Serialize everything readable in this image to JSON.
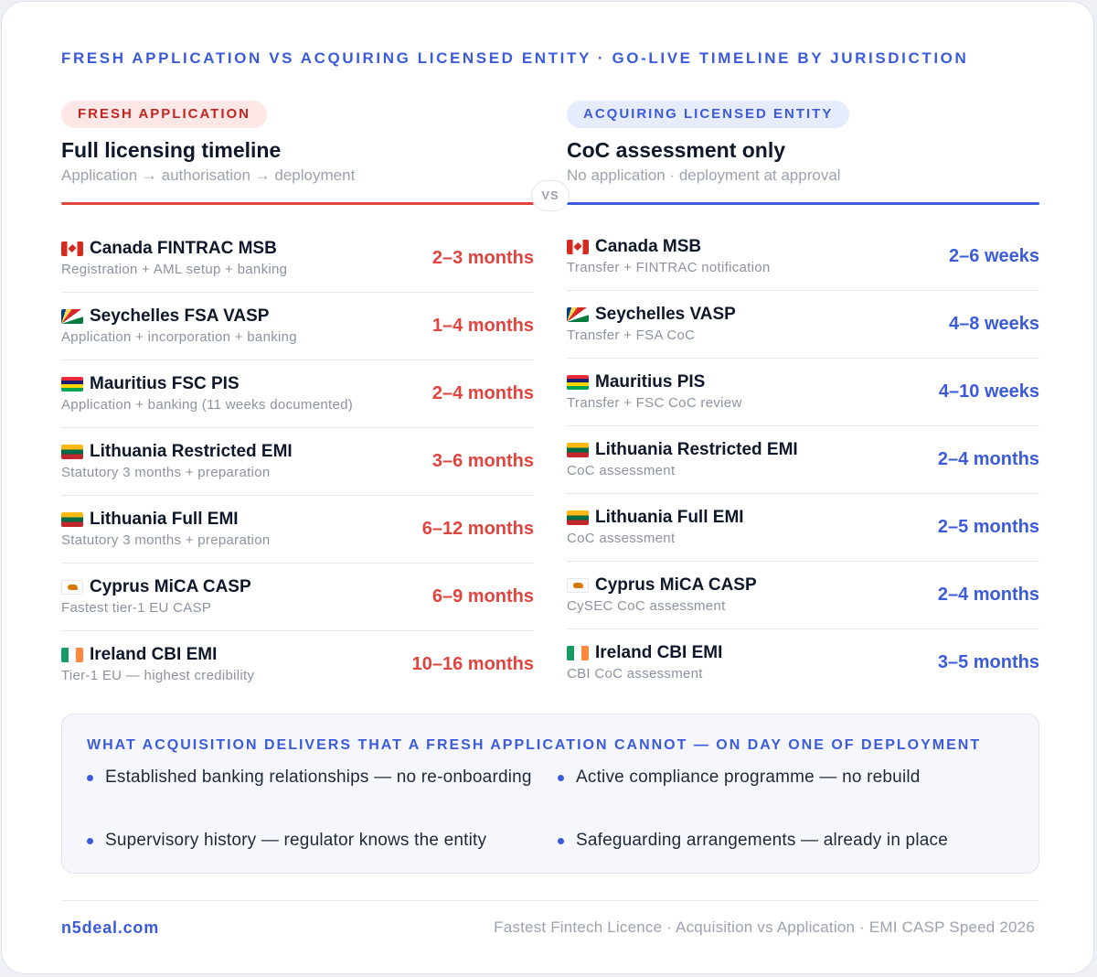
{
  "header": {
    "title": "FRESH APPLICATION VS ACQUIRING LICENSED ENTITY · GO-LIVE TIMELINE BY JURISDICTION"
  },
  "left": {
    "pill": "FRESH APPLICATION",
    "heading": "Full licensing timeline",
    "sub": "Application → authorisation → deployment",
    "accent_color": "#e0443e",
    "rows": [
      {
        "flag": "canada-flag",
        "name": "Canada FINTRAC MSB",
        "desc": "Registration + AML setup + banking",
        "value": "2–3 months"
      },
      {
        "flag": "seychelles-flag",
        "name": "Seychelles FSA VASP",
        "desc": "Application + incorporation + banking",
        "value": "1–4 months"
      },
      {
        "flag": "mauritius-flag",
        "name": "Mauritius FSC PIS",
        "desc": "Application + banking (11 weeks documented)",
        "value": "2–4 months"
      },
      {
        "flag": "lithuania-flag",
        "name": "Lithuania Restricted EMI",
        "desc": "Statutory 3 months + preparation",
        "value": "3–6 months"
      },
      {
        "flag": "lithuania-flag",
        "name": "Lithuania Full EMI",
        "desc": "Statutory 3 months + preparation",
        "value": "6–12 months"
      },
      {
        "flag": "cyprus-flag",
        "name": "Cyprus MiCA CASP",
        "desc": "Fastest tier-1 EU CASP",
        "value": "6–9 months"
      },
      {
        "flag": "ireland-flag",
        "name": "Ireland CBI EMI",
        "desc": "Tier-1 EU — highest credibility",
        "value": "10–16 months"
      }
    ]
  },
  "vs_label": "VS",
  "right": {
    "pill": "ACQUIRING LICENSED ENTITY",
    "heading": "CoC assessment only",
    "sub": "No application · deployment at approval",
    "accent_color": "#3b5bdb",
    "rows": [
      {
        "flag": "canada-flag",
        "name": "Canada MSB",
        "desc": "Transfer + FINTRAC notification",
        "value": "2–6 weeks"
      },
      {
        "flag": "seychelles-flag",
        "name": "Seychelles VASP",
        "desc": "Transfer + FSA CoC",
        "value": "4–8 weeks"
      },
      {
        "flag": "mauritius-flag",
        "name": "Mauritius PIS",
        "desc": "Transfer + FSC CoC review",
        "value": "4–10 weeks"
      },
      {
        "flag": "lithuania-flag",
        "name": "Lithuania Restricted EMI",
        "desc": "CoC assessment",
        "value": "2–4 months"
      },
      {
        "flag": "lithuania-flag",
        "name": "Lithuania Full EMI",
        "desc": "CoC assessment",
        "value": "2–5 months"
      },
      {
        "flag": "cyprus-flag",
        "name": "Cyprus MiCA CASP",
        "desc": "CySEC CoC assessment",
        "value": "2–4 months"
      },
      {
        "flag": "ireland-flag",
        "name": "Ireland CBI EMI",
        "desc": "CBI CoC assessment",
        "value": "3–5 months"
      }
    ]
  },
  "panel": {
    "title": "WHAT ACQUISITION DELIVERS THAT A FRESH APPLICATION CANNOT — ON DAY ONE OF DEPLOYMENT",
    "bullets": [
      "Established banking relationships — no re-onboarding",
      "Active compliance programme — no rebuild",
      "Supervisory history — regulator knows the entity",
      "Safeguarding arrangements — already in place"
    ]
  },
  "footer": {
    "brand": "n5deal.com",
    "meta": "Fastest Fintech Licence · Acquisition vs Application · EMI CASP Speed 2026"
  }
}
